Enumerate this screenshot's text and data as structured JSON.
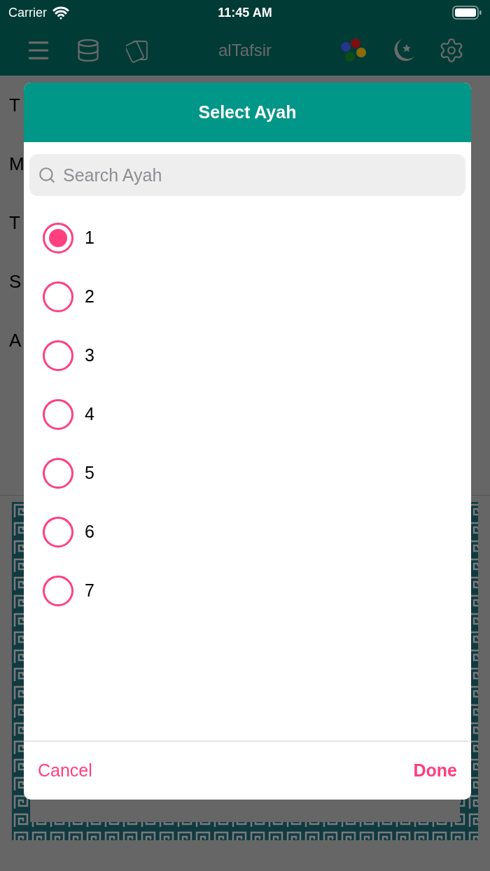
{
  "status_bar": {
    "carrier": "Carrier",
    "time": "11:45 AM"
  },
  "nav_bar": {
    "title": "alTafsir"
  },
  "background_rows": [
    {
      "label": "T"
    },
    {
      "label": "M"
    },
    {
      "label": "T"
    },
    {
      "label": "S"
    },
    {
      "label": "A"
    }
  ],
  "dialog": {
    "title": "Select Ayah",
    "search": {
      "placeholder": "Search Ayah"
    },
    "options": [
      {
        "label": "1",
        "selected": true
      },
      {
        "label": "2",
        "selected": false
      },
      {
        "label": "3",
        "selected": false
      },
      {
        "label": "4",
        "selected": false
      },
      {
        "label": "5",
        "selected": false
      },
      {
        "label": "6",
        "selected": false
      },
      {
        "label": "7",
        "selected": false
      }
    ],
    "buttons": [
      {
        "label": "Cancel",
        "kind": "secondary"
      },
      {
        "label": "Done",
        "kind": "primary"
      }
    ]
  }
}
